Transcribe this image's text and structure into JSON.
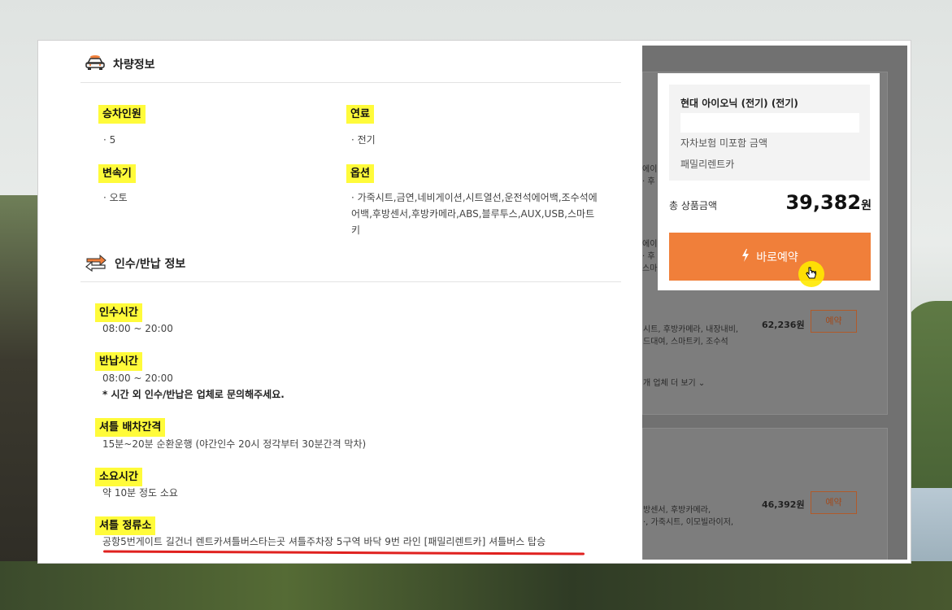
{
  "vehicle_info": {
    "title": "차량정보",
    "capacity_label": "승차인원",
    "capacity_value": "· 5",
    "fuel_label": "연료",
    "fuel_value": "· 전기",
    "transmission_label": "변속기",
    "transmission_value": "· 오토",
    "options_label": "옵션",
    "options_value": "· 가죽시트,금연,네비게이션,시트열선,운전석에어백,조수석에어백,후방센서,후방카메라,ABS,블루투스,AUX,USB,스마트키"
  },
  "pickup_return": {
    "title": "인수/반납 정보",
    "pickup_time_label": "인수시간",
    "pickup_time_value": "08:00 ~ 20:00",
    "return_time_label": "반납시간",
    "return_time_value": "08:00 ~ 20:00",
    "return_note": "* 시간 외 인수/반납은 업체로 문의해주세요.",
    "shuttle_interval_label": "셔틀 배차간격",
    "shuttle_interval_value": "15분~20분 순환운행 (야간인수 20시 정각부터 30분간격 막차)",
    "duration_label": "소요시간",
    "duration_value": "약 10분 정도 소요",
    "shuttle_stop_label": "셔틀 정류소",
    "shuttle_stop_value": "공항5번게이트 길건너 렌트카셔틀버스타는곳 셔틀주차장 5구역 바닥 9번 라인 [패밀리렌트카] 셔틀버스 탑승"
  },
  "background_list": {
    "card1_line1": "에이",
    "card1_line2": "· 후",
    "card1_line3": "에이",
    "card1_line4": "· 후",
    "card1_line5": "스마",
    "row1_text1": "시트, 후방카메라, 내장내비,",
    "row1_text2": "드대여, 스마트키, 조수석",
    "row1_price": "62,236원",
    "row1_button": "예약",
    "more_link": "개 업체 더 보기 ⌄",
    "row2_text1": "방센서, 후방카메라,",
    "row2_text2": "·, 가죽시트, 이모빌라이저,",
    "row2_price": "46,392원",
    "row2_button": "예약"
  },
  "popup": {
    "car_name": "현대 아이오닉 (전기) (전기)",
    "insurance_note": "자차보험 미포함 금액",
    "company": "패밀리렌트카",
    "total_label": "총 상품금액",
    "total_amount": "39,382",
    "total_unit": "원",
    "book_button": "바로예약"
  },
  "colors": {
    "highlight": "#fffb3a",
    "accent_orange": "#f07f3a",
    "underline_red": "#e0211f"
  },
  "icons": [
    "car-icon",
    "exchange-arrows-icon",
    "lightning-icon",
    "hand-pointer-icon"
  ]
}
